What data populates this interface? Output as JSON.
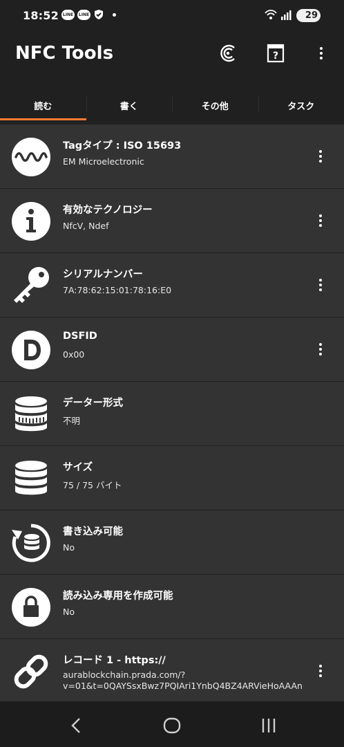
{
  "status_bar": {
    "time": "18:52",
    "notification_icons": [
      "line-icon",
      "line-icon",
      "shield-check-icon"
    ],
    "battery": "29"
  },
  "app": {
    "title": "NFC Tools"
  },
  "tabs": [
    {
      "label": "読む",
      "active": true
    },
    {
      "label": "書く",
      "active": false
    },
    {
      "label": "その他",
      "active": false
    },
    {
      "label": "タスク",
      "active": false
    }
  ],
  "rows": [
    {
      "icon": "wave-icon",
      "title": "Tagタイプ : ISO 15693",
      "value": "EM Microelectronic"
    },
    {
      "icon": "info-icon",
      "title": "有効なテクノロジー",
      "value": "NfcV, Ndef"
    },
    {
      "icon": "key-icon",
      "title": "シリアルナンバー",
      "value": "7A:78:62:15:01:78:16:E0"
    },
    {
      "icon": "letter-d-icon",
      "title": "DSFID",
      "value": "0x00"
    },
    {
      "icon": "database-format-icon",
      "title": "データー形式",
      "value": "不明"
    },
    {
      "icon": "database-icon",
      "title": "サイズ",
      "value": "75 / 75 バイト"
    },
    {
      "icon": "database-refresh-icon",
      "title": "書き込み可能",
      "value": "No"
    },
    {
      "icon": "lock-icon",
      "title": "読み込み専用を作成可能",
      "value": "No"
    },
    {
      "icon": "link-icon",
      "title": "レコード 1 - https://",
      "value": "aurablockchain.prada.com/?v=01&t=0QAYSsxBwz7PQIAri1YnbQ4BZ4ARVieHoAAAn"
    }
  ],
  "colors": {
    "accent": "#ff7a35",
    "row_bg": "#333333",
    "bar_bg": "#202020"
  }
}
